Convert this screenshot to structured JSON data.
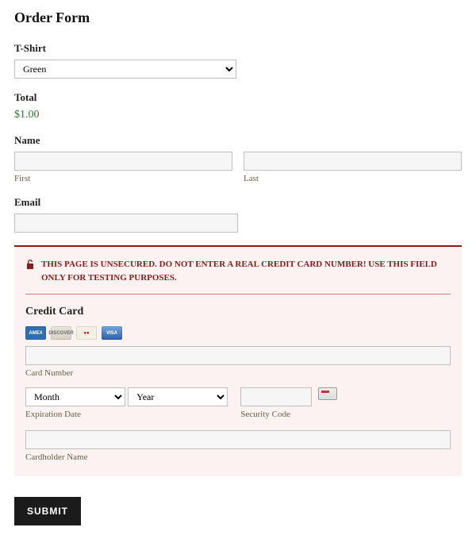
{
  "title": "Order Form",
  "tshirt": {
    "label": "T-Shirt",
    "selected": "Green"
  },
  "total": {
    "label": "Total",
    "value": "$1.00"
  },
  "name": {
    "label": "Name",
    "first_sub": "First",
    "last_sub": "Last",
    "first_value": "",
    "last_value": ""
  },
  "email": {
    "label": "Email",
    "value": ""
  },
  "cc": {
    "warning": "THIS PAGE IS UNSECURED. DO NOT ENTER A REAL CREDIT CARD NUMBER! USE THIS FIELD ONLY FOR TESTING PURPOSES.",
    "heading": "Credit Card",
    "logos": {
      "amex": "AMEX",
      "discover": "DISCOVER",
      "mc": "●●",
      "visa": "VISA"
    },
    "card_number_label": "Card Number",
    "card_number_value": "",
    "month_placeholder": "Month",
    "year_placeholder": "Year",
    "expiration_label": "Expiration Date",
    "security_label": "Security Code",
    "security_value": "",
    "cardholder_label": "Cardholder Name",
    "cardholder_value": ""
  },
  "submit_label": "SUBMIT"
}
